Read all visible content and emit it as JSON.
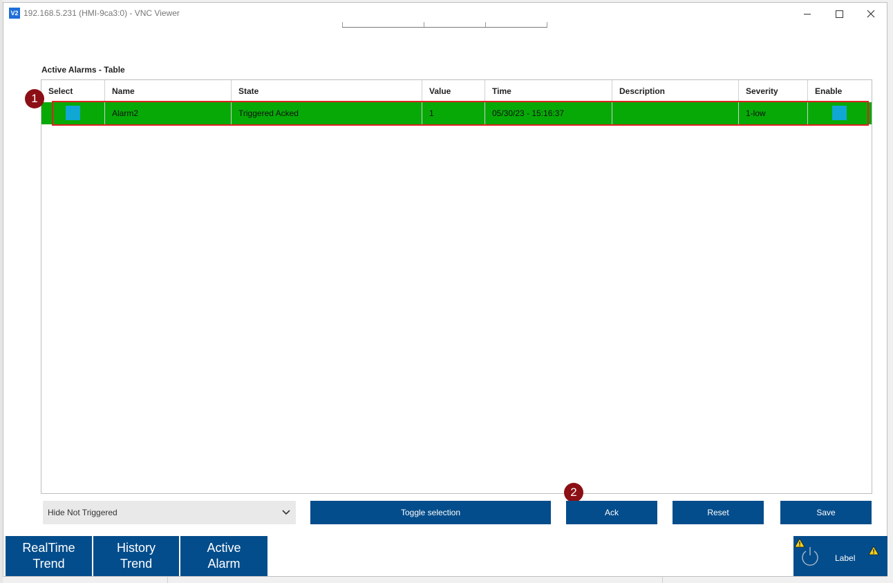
{
  "window": {
    "title": "192.168.5.231 (HMI-9ca3:0) - VNC Viewer",
    "app_icon": "V2"
  },
  "section_title": "Active Alarms - Table",
  "table": {
    "columns": [
      "Select",
      "Name",
      "State",
      "Value",
      "Time",
      "Description",
      "Severity",
      "Enable"
    ],
    "rows": [
      {
        "name": "Alarm2",
        "state": "Triggered Acked",
        "value": "1",
        "time": "05/30/23 - 15:16:37",
        "description": "",
        "severity": "1-low",
        "row_color": "#07a907"
      }
    ]
  },
  "annotations": {
    "badge_1": "1",
    "badge_2": "2",
    "highlight_color": "#e02020",
    "badge_color": "#8b0f14"
  },
  "filter": {
    "selected": "Hide Not Triggered"
  },
  "buttons": {
    "toggle": "Toggle selection",
    "ack": "Ack",
    "reset": "Reset",
    "save": "Save"
  },
  "nav": {
    "realtime": "RealTime\nTrend",
    "history": "History\nTrend",
    "active": "Active\nAlarm"
  },
  "status": {
    "label": "Label"
  },
  "colors": {
    "primary": "#044d8c",
    "checkbox": "#10a7d4"
  }
}
